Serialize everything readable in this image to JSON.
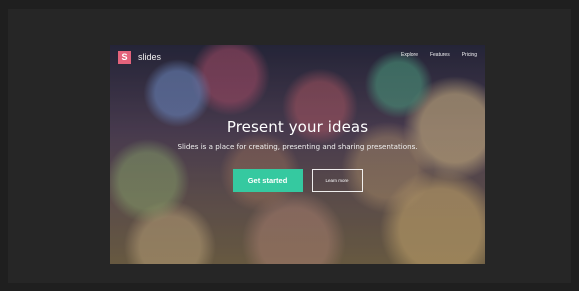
{
  "brand": {
    "logo_letter": "S",
    "name": "slides"
  },
  "nav": {
    "items": [
      {
        "label": "Explore"
      },
      {
        "label": "Features"
      },
      {
        "label": "Pricing"
      }
    ]
  },
  "hero": {
    "headline": "Present your ideas",
    "subhead": "Slides is a place for creating, presenting and sharing presentations.",
    "primary_cta": "Get started",
    "secondary_cta": "Learn more"
  },
  "colors": {
    "logo_accent": "#e4637c",
    "cta_accent": "#35c9a0"
  }
}
